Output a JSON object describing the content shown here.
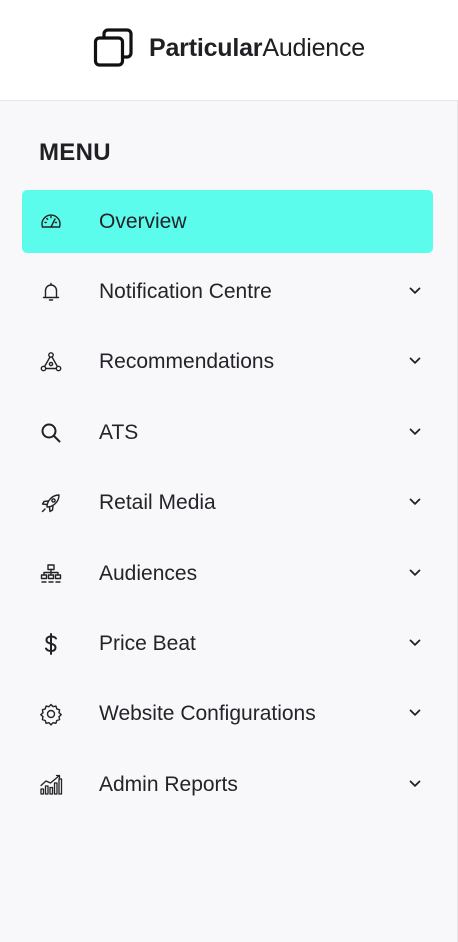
{
  "brand": {
    "name_strong": "Particular",
    "name_light": "Audience"
  },
  "menu": {
    "heading": "MENU",
    "items": [
      {
        "label": "Overview",
        "icon": "speedometer-icon",
        "active": true,
        "expandable": false
      },
      {
        "label": "Notification Centre",
        "icon": "bell-icon",
        "active": false,
        "expandable": true
      },
      {
        "label": "Recommendations",
        "icon": "nodes-icon",
        "active": false,
        "expandable": true
      },
      {
        "label": "ATS",
        "icon": "search-icon",
        "active": false,
        "expandable": true
      },
      {
        "label": "Retail Media",
        "icon": "rocket-icon",
        "active": false,
        "expandable": true
      },
      {
        "label": "Audiences",
        "icon": "hierarchy-icon",
        "active": false,
        "expandable": true
      },
      {
        "label": "Price Beat",
        "icon": "dollar-icon",
        "active": false,
        "expandable": true
      },
      {
        "label": "Website Configurations",
        "icon": "gear-icon",
        "active": false,
        "expandable": true
      },
      {
        "label": "Admin Reports",
        "icon": "bar-chart-icon",
        "active": false,
        "expandable": true
      }
    ]
  },
  "colors": {
    "active_bg": "#5cfcec",
    "page_bg": "#f8f8fa",
    "text": "#1f1f24"
  }
}
